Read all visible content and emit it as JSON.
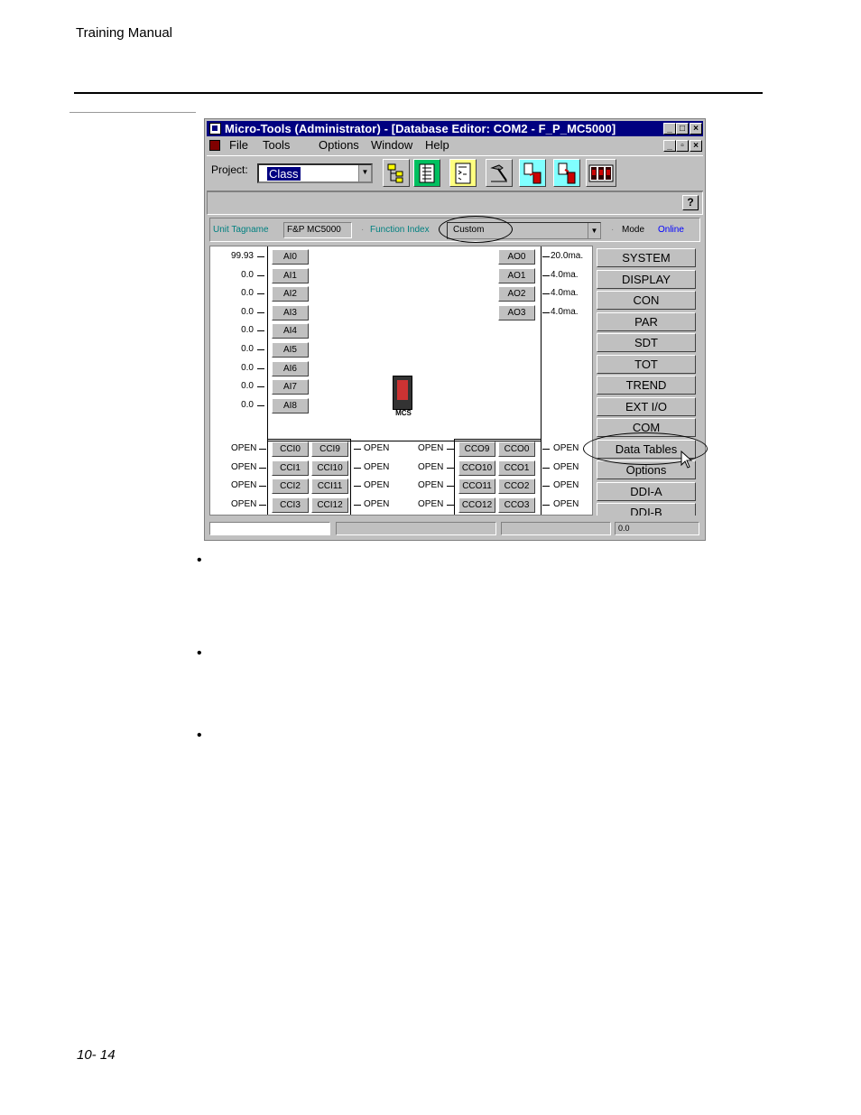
{
  "page": {
    "header": "Training Manual",
    "page_number": "10- 14",
    "bullets": [
      "•",
      "•",
      "•"
    ]
  },
  "window": {
    "title": "Micro-Tools (Administrator) - [Database Editor: COM2 - F_P_MC5000]",
    "menu": [
      "File",
      "Tools",
      "Options",
      "Window",
      "Help"
    ],
    "project_label": "Project:",
    "project_value": "Class",
    "help_button": "?",
    "unit_tagname_label": "Unit Tagname",
    "unit_tagname_value": "F&P MC5000",
    "function_index_label": "Function Index",
    "function_index_value": "Custom",
    "mode_label": "Mode",
    "mode_value": "Online",
    "device_label": "MCS",
    "status_value": "0.0"
  },
  "analog_inputs": [
    {
      "label": "AI0",
      "value": "99.93"
    },
    {
      "label": "AI1",
      "value": "0.0"
    },
    {
      "label": "AI2",
      "value": "0.0"
    },
    {
      "label": "AI3",
      "value": "0.0"
    },
    {
      "label": "AI4",
      "value": "0.0"
    },
    {
      "label": "AI5",
      "value": "0.0"
    },
    {
      "label": "AI6",
      "value": "0.0"
    },
    {
      "label": "AI7",
      "value": "0.0"
    },
    {
      "label": "AI8",
      "value": "0.0"
    }
  ],
  "analog_outputs": [
    {
      "label": "AO0",
      "value": "20.0ma."
    },
    {
      "label": "AO1",
      "value": "4.0ma."
    },
    {
      "label": "AO2",
      "value": "4.0ma."
    },
    {
      "label": "AO3",
      "value": "4.0ma."
    }
  ],
  "contact_inputs": [
    {
      "left": "CCI0",
      "right": "CCI9",
      "left_value": "OPEN",
      "right_value": "OPEN"
    },
    {
      "left": "CCI1",
      "right": "CCI10",
      "left_value": "OPEN",
      "right_value": "OPEN"
    },
    {
      "left": "CCI2",
      "right": "CCI11",
      "left_value": "OPEN",
      "right_value": "OPEN"
    },
    {
      "left": "CCI3",
      "right": "CCI12",
      "left_value": "OPEN",
      "right_value": "OPEN"
    }
  ],
  "contact_outputs": [
    {
      "left": "CCO9",
      "right": "CCO0",
      "left_value": "OPEN",
      "right_value": "OPEN"
    },
    {
      "left": "CCO10",
      "right": "CCO1",
      "left_value": "OPEN",
      "right_value": "OPEN"
    },
    {
      "left": "CCO11",
      "right": "CCO2",
      "left_value": "OPEN",
      "right_value": "OPEN"
    },
    {
      "left": "CCO12",
      "right": "CCO3",
      "left_value": "OPEN",
      "right_value": "OPEN"
    }
  ],
  "side_buttons": [
    "SYSTEM",
    "DISPLAY",
    "CON",
    "PAR",
    "SDT",
    "TOT",
    "TREND",
    "EXT I/O",
    "COM",
    "Data Tables",
    "Options",
    "DDI-A",
    "DDI-B"
  ],
  "colors": {
    "title_bar": "#000080",
    "teal_label": "#008080",
    "online": "#0000ff",
    "face": "#c0c0c0"
  }
}
